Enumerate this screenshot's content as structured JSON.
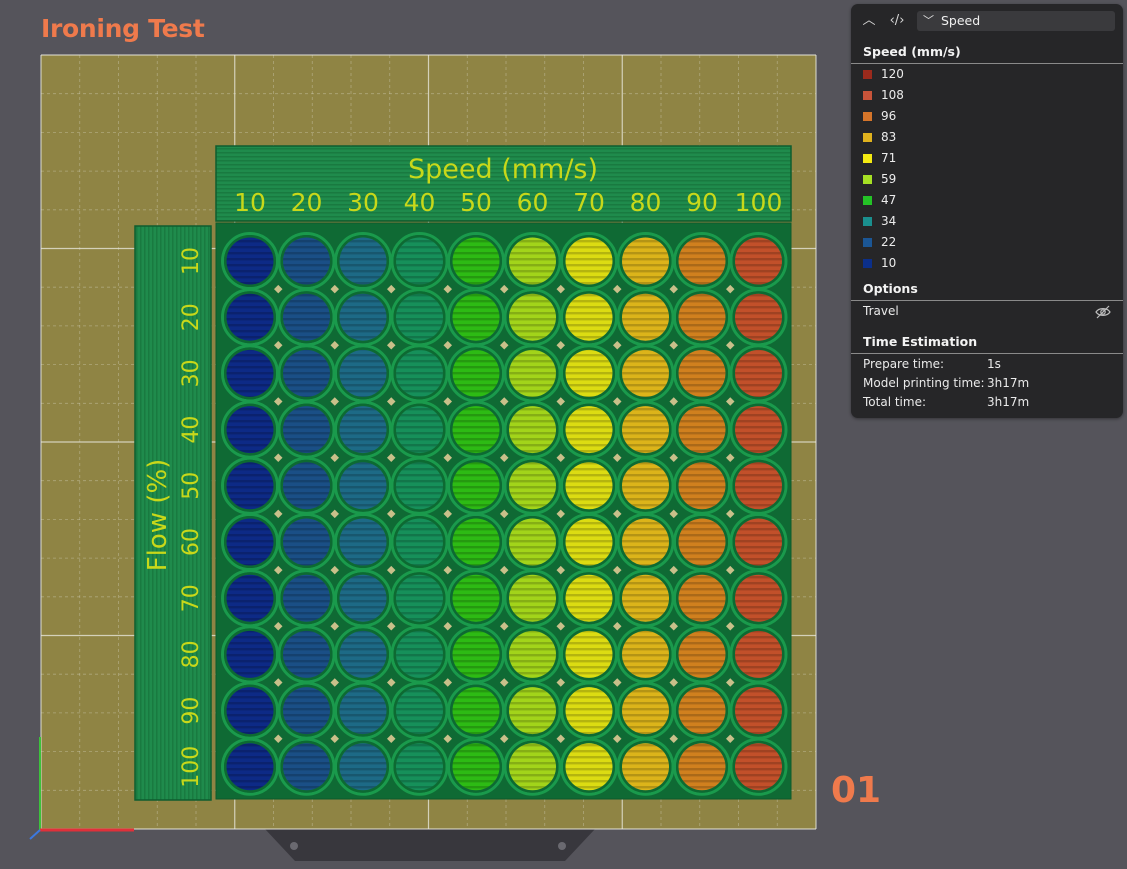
{
  "title": "Ironing Test",
  "plate_number": "01",
  "model": {
    "speed_label": "Speed (mm/s)",
    "speed_values": [
      "10",
      "20",
      "30",
      "40",
      "50",
      "60",
      "70",
      "80",
      "90",
      "100"
    ],
    "flow_label": "Flow (%)",
    "flow_values": [
      "10",
      "20",
      "30",
      "40",
      "50",
      "60",
      "70",
      "80",
      "90",
      "100"
    ]
  },
  "legend": {
    "view_select": "Speed",
    "speed_title": "Speed (mm/s)",
    "items": [
      {
        "label": "120",
        "color": "#9b2a1c"
      },
      {
        "label": "108",
        "color": "#c8543a"
      },
      {
        "label": "96",
        "color": "#d5752a"
      },
      {
        "label": "83",
        "color": "#e0b21e"
      },
      {
        "label": "71",
        "color": "#f4ea12"
      },
      {
        "label": "59",
        "color": "#a6e024"
      },
      {
        "label": "47",
        "color": "#24c226"
      },
      {
        "label": "34",
        "color": "#1a8f8e"
      },
      {
        "label": "22",
        "color": "#1b5695"
      },
      {
        "label": "10",
        "color": "#0b2f8a"
      }
    ],
    "options_title": "Options",
    "options": [
      {
        "label": "Travel",
        "icon": "eye-off-icon"
      }
    ],
    "time_title": "Time Estimation",
    "time_rows": [
      {
        "key": "Prepare time:",
        "value": "1s"
      },
      {
        "key": "Model printing time:",
        "value": "3h17m"
      },
      {
        "key": "Total time:",
        "value": "3h17m"
      }
    ]
  },
  "column_colors": [
    "#0d2a86",
    "#1a4f86",
    "#1d6a86",
    "#16905a",
    "#2dbb14",
    "#a2d41a",
    "#dcdc12",
    "#dcb41a",
    "#d0801e",
    "#c2502a"
  ]
}
